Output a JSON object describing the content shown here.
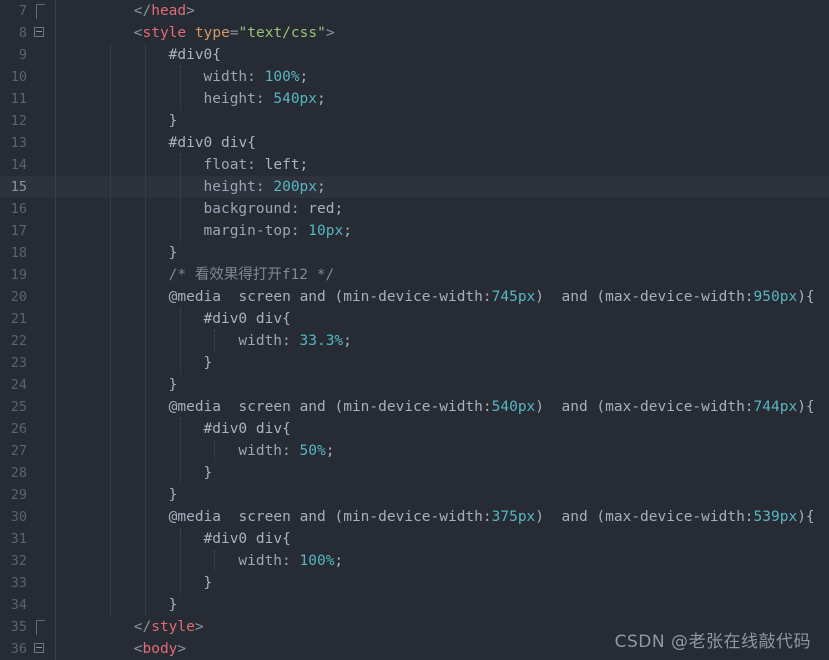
{
  "editor": {
    "theme_background": "#272b33",
    "active_line_background": "#2e323c",
    "gutter_color": "#5b6270",
    "colors": {
      "tag": "#e06c75",
      "attribute": "#d19a66",
      "string": "#98c379",
      "property": "#9aa5b8",
      "value": "#56b6c2",
      "comment": "#7f8896",
      "plain": "#abb2bf"
    },
    "active_line_number": 15,
    "lines": [
      {
        "number": "7",
        "fold": "bracket-end",
        "indent": 2,
        "tokens": [
          {
            "t": "punct",
            "v": "</"
          },
          {
            "t": "tag",
            "v": "head"
          },
          {
            "t": "punct",
            "v": ">"
          }
        ]
      },
      {
        "number": "8",
        "fold": "box-minus",
        "indent": 2,
        "tokens": [
          {
            "t": "punct",
            "v": "<"
          },
          {
            "t": "tag",
            "v": "style"
          },
          {
            "t": "plain",
            "v": " "
          },
          {
            "t": "attr",
            "v": "type"
          },
          {
            "t": "eq",
            "v": "="
          },
          {
            "t": "string",
            "v": "\"text/css\""
          },
          {
            "t": "punct",
            "v": ">"
          }
        ]
      },
      {
        "number": "9",
        "fold": "",
        "indent": 3,
        "tokens": [
          {
            "t": "sel",
            "v": "#div0{"
          }
        ]
      },
      {
        "number": "10",
        "fold": "",
        "indent": 4,
        "tokens": [
          {
            "t": "prop",
            "v": "width: "
          },
          {
            "t": "val",
            "v": "100%"
          },
          {
            "t": "plain",
            "v": ";"
          }
        ]
      },
      {
        "number": "11",
        "fold": "",
        "indent": 4,
        "tokens": [
          {
            "t": "prop",
            "v": "height: "
          },
          {
            "t": "val",
            "v": "540px"
          },
          {
            "t": "plain",
            "v": ";"
          }
        ]
      },
      {
        "number": "12",
        "fold": "",
        "indent": 3,
        "tokens": [
          {
            "t": "brace",
            "v": "}"
          }
        ]
      },
      {
        "number": "13",
        "fold": "",
        "indent": 3,
        "tokens": [
          {
            "t": "sel",
            "v": "#div0 div{"
          }
        ]
      },
      {
        "number": "14",
        "fold": "",
        "indent": 4,
        "tokens": [
          {
            "t": "prop",
            "v": "float: "
          },
          {
            "t": "plain",
            "v": "left;"
          }
        ]
      },
      {
        "number": "15",
        "fold": "",
        "indent": 4,
        "active": true,
        "tokens": [
          {
            "t": "prop",
            "v": "height: "
          },
          {
            "t": "val",
            "v": "200px"
          },
          {
            "t": "plain",
            "v": ";"
          }
        ]
      },
      {
        "number": "16",
        "fold": "",
        "indent": 4,
        "tokens": [
          {
            "t": "prop",
            "v": "background: "
          },
          {
            "t": "plain",
            "v": "red;"
          }
        ]
      },
      {
        "number": "17",
        "fold": "",
        "indent": 4,
        "tokens": [
          {
            "t": "prop",
            "v": "margin-top: "
          },
          {
            "t": "val",
            "v": "10px"
          },
          {
            "t": "plain",
            "v": ";"
          }
        ]
      },
      {
        "number": "18",
        "fold": "",
        "indent": 3,
        "tokens": [
          {
            "t": "brace",
            "v": "}"
          }
        ]
      },
      {
        "number": "19",
        "fold": "",
        "indent": 3,
        "tokens": [
          {
            "t": "comment",
            "v": "/* 看效果得打开f12 */"
          }
        ]
      },
      {
        "number": "20",
        "fold": "",
        "indent": 3,
        "tokens": [
          {
            "t": "at",
            "v": "@media  screen and (min-device-width:"
          },
          {
            "t": "val",
            "v": "745px"
          },
          {
            "t": "at",
            "v": ")  and (max-device-width:"
          },
          {
            "t": "val",
            "v": "950px"
          },
          {
            "t": "at",
            "v": "){"
          }
        ]
      },
      {
        "number": "21",
        "fold": "",
        "indent": 4,
        "tokens": [
          {
            "t": "sel",
            "v": "#div0 div{"
          }
        ]
      },
      {
        "number": "22",
        "fold": "",
        "indent": 5,
        "tokens": [
          {
            "t": "prop",
            "v": "width: "
          },
          {
            "t": "val",
            "v": "33.3%"
          },
          {
            "t": "plain",
            "v": ";"
          }
        ]
      },
      {
        "number": "23",
        "fold": "",
        "indent": 4,
        "tokens": [
          {
            "t": "brace",
            "v": "}"
          }
        ]
      },
      {
        "number": "24",
        "fold": "",
        "indent": 3,
        "tokens": [
          {
            "t": "brace",
            "v": "}"
          }
        ]
      },
      {
        "number": "25",
        "fold": "",
        "indent": 3,
        "tokens": [
          {
            "t": "at",
            "v": "@media  screen and (min-device-width:"
          },
          {
            "t": "val",
            "v": "540px"
          },
          {
            "t": "at",
            "v": ")  and (max-device-width:"
          },
          {
            "t": "val",
            "v": "744px"
          },
          {
            "t": "at",
            "v": "){"
          }
        ]
      },
      {
        "number": "26",
        "fold": "",
        "indent": 4,
        "tokens": [
          {
            "t": "sel",
            "v": "#div0 div{"
          }
        ]
      },
      {
        "number": "27",
        "fold": "",
        "indent": 5,
        "tokens": [
          {
            "t": "prop",
            "v": "width: "
          },
          {
            "t": "val",
            "v": "50%"
          },
          {
            "t": "plain",
            "v": ";"
          }
        ]
      },
      {
        "number": "28",
        "fold": "",
        "indent": 4,
        "tokens": [
          {
            "t": "brace",
            "v": "}"
          }
        ]
      },
      {
        "number": "29",
        "fold": "",
        "indent": 3,
        "tokens": [
          {
            "t": "brace",
            "v": "}"
          }
        ]
      },
      {
        "number": "30",
        "fold": "",
        "indent": 3,
        "tokens": [
          {
            "t": "at",
            "v": "@media  screen and (min-device-width:"
          },
          {
            "t": "val",
            "v": "375px"
          },
          {
            "t": "at",
            "v": ")  and (max-device-width:"
          },
          {
            "t": "val",
            "v": "539px"
          },
          {
            "t": "at",
            "v": "){"
          }
        ]
      },
      {
        "number": "31",
        "fold": "",
        "indent": 4,
        "tokens": [
          {
            "t": "sel",
            "v": "#div0 div{"
          }
        ]
      },
      {
        "number": "32",
        "fold": "",
        "indent": 5,
        "tokens": [
          {
            "t": "prop",
            "v": "width: "
          },
          {
            "t": "val",
            "v": "100%"
          },
          {
            "t": "plain",
            "v": ";"
          }
        ]
      },
      {
        "number": "33",
        "fold": "",
        "indent": 4,
        "tokens": [
          {
            "t": "brace",
            "v": "}"
          }
        ]
      },
      {
        "number": "34",
        "fold": "",
        "indent": 3,
        "tokens": [
          {
            "t": "brace",
            "v": "}"
          }
        ]
      },
      {
        "number": "35",
        "fold": "bracket-end",
        "indent": 2,
        "tokens": [
          {
            "t": "punct",
            "v": "</"
          },
          {
            "t": "tag",
            "v": "style"
          },
          {
            "t": "punct",
            "v": ">"
          }
        ]
      },
      {
        "number": "36",
        "fold": "box-minus",
        "indent": 2,
        "tokens": [
          {
            "t": "punct",
            "v": "<"
          },
          {
            "t": "tag",
            "v": "body"
          },
          {
            "t": "punct",
            "v": ">"
          }
        ]
      }
    ]
  },
  "watermark": {
    "text": "CSDN @老张在线敲代码"
  }
}
